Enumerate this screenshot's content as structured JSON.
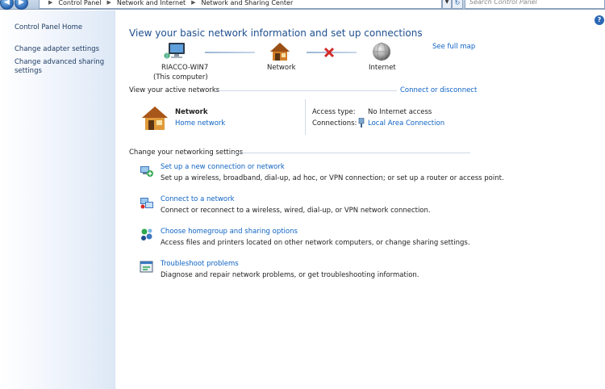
{
  "address_bar": {
    "crumbs": [
      "Control Panel",
      "Network and Internet",
      "Network and Sharing Center"
    ],
    "search_placeholder": "Search Control Panel"
  },
  "left_pane": {
    "items": [
      "Control Panel Home",
      "Change adapter settings",
      "Change advanced sharing settings"
    ]
  },
  "header": {
    "title": "View your basic network information and set up connections",
    "see_full_map": "See full map"
  },
  "network_map": {
    "computer_name": "RIACCO-WIN7",
    "computer_sub": "(This computer)",
    "network_label": "Network",
    "internet_label": "Internet"
  },
  "active_networks": {
    "heading": "View your active networks",
    "connect_link": "Connect or disconnect",
    "network_name": "Network",
    "network_type": "Home network",
    "access_type_label": "Access type:",
    "access_type_value": "No Internet access",
    "connections_label": "Connections:",
    "connections_value": "Local Area Connection"
  },
  "networking_settings": {
    "heading": "Change your networking settings",
    "tasks": [
      {
        "title": "Set up a new connection or network",
        "desc": "Set up a wireless, broadband, dial-up, ad hoc, or VPN connection; or set up a router or access point."
      },
      {
        "title": "Connect to a network",
        "desc": "Connect or reconnect to a wireless, wired, dial-up, or VPN network connection."
      },
      {
        "title": "Choose homegroup and sharing options",
        "desc": "Access files and printers located on other network computers, or change sharing settings."
      },
      {
        "title": "Troubleshoot problems",
        "desc": "Diagnose and repair network problems, or get troubleshooting information."
      }
    ]
  },
  "colors": {
    "link": "#0e63c4",
    "title": "#1e4f8f",
    "pane_gradient_end": "#dde8f6",
    "error_x": "#d42a2a"
  }
}
